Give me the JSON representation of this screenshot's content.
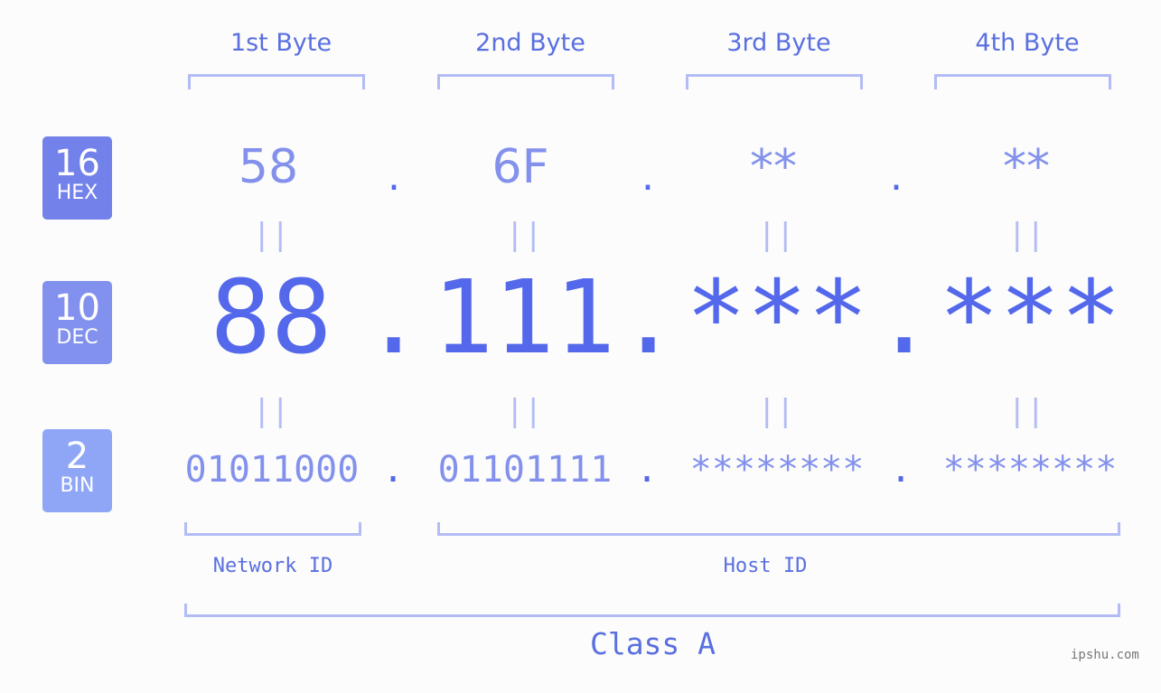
{
  "bytes": [
    {
      "label": "1st Byte",
      "hex": "58",
      "dec": "88",
      "bin": "01011000"
    },
    {
      "label": "2nd Byte",
      "hex": "6F",
      "dec": "111",
      "bin": "01101111"
    },
    {
      "label": "3rd Byte",
      "hex": "**",
      "dec": "***",
      "bin": "********"
    },
    {
      "label": "4th Byte",
      "hex": "**",
      "dec": "***",
      "bin": "********"
    }
  ],
  "badges": {
    "hex": {
      "num": "16",
      "label": "HEX",
      "color": "#7381ea"
    },
    "dec": {
      "num": "10",
      "label": "DEC",
      "color": "#8290ee"
    },
    "bin": {
      "num": "2",
      "label": "BIN",
      "color": "#8fa6f7"
    }
  },
  "separator": ".",
  "equals": "||",
  "network_id_label": "Network ID",
  "host_id_label": "Host ID",
  "class_label": "Class A",
  "watermark": "ipshu.com"
}
